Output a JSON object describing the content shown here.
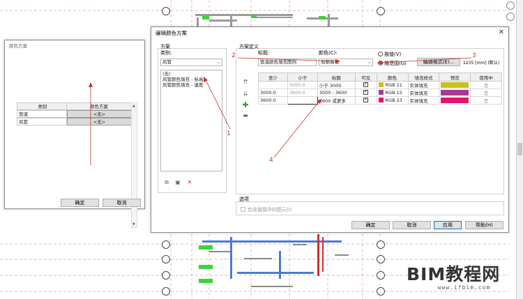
{
  "small_dialog": {
    "title": "颜色方案",
    "headers": [
      "类别",
      "颜色方案"
    ],
    "rows": [
      {
        "category": "管道",
        "scheme": "<无>"
      },
      {
        "category": "风管",
        "scheme": "<无>"
      }
    ],
    "ok_label": "确定",
    "cancel_label": "取消"
  },
  "main_dialog": {
    "title": "编辑颜色方案",
    "close_glyph": "✕",
    "scheme_group_label": "方案",
    "category_label": "类别:",
    "category_value": "风管",
    "scheme_list": [
      "(无)",
      "风管颜色填充 - 标高",
      "风管颜色填充 - 速度"
    ],
    "definition_group_label": "方案定义",
    "title_label": "标题:",
    "title_value": "管道颜色填充图例",
    "color_label": "颜色(C):",
    "color_value": "局部高程",
    "by_value_label": "按值(V)",
    "by_range_label": "按范围(G)",
    "edit_format_label": "编辑格式(E)...",
    "unit_hint": "1235 [mm] (默认)",
    "table": {
      "headers": [
        "至少",
        "小于",
        "标题",
        "可见",
        "颜色",
        "填充样式",
        "预览",
        "使用中"
      ],
      "rows": [
        {
          "at_least": "",
          "less_than": "3000.0",
          "caption": "小于 3000",
          "color_label": "RGB 21",
          "color": "#c9c11c",
          "fill": "实体填充",
          "in_use": "是"
        },
        {
          "at_least": "3000.0",
          "less_than": "3600.0",
          "caption": "3000 - 3600",
          "color_label": "RGB 15",
          "color": "#a83a8e",
          "fill": "实体填充",
          "in_use": "是"
        },
        {
          "at_least": "3600.0",
          "less_than": "",
          "caption": "3600 或更多",
          "color_label": "RGB 23",
          "color": "#e0146e",
          "fill": "实体填充",
          "in_use": "是"
        }
      ]
    },
    "options_label": "选项",
    "include_links_label": "包含链接中的图元(I)",
    "ok_label": "确定",
    "cancel_label": "取消",
    "apply_label": "应用",
    "help_label": "帮助(H)"
  },
  "annotations": [
    "1",
    "2",
    "3",
    "4"
  ],
  "watermark": {
    "title": "BIM教程网",
    "url": "www.ifbim.com"
  },
  "colors": {
    "annotation": "#cc3030",
    "accent": "#0078d7"
  }
}
